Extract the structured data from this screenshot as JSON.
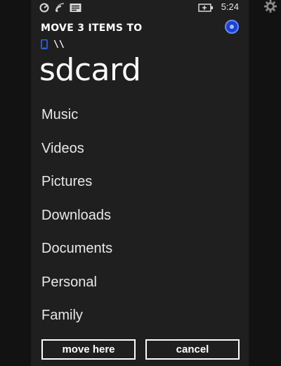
{
  "status_bar": {
    "time": "5:24",
    "icons": [
      "sync-icon",
      "wifi-icon",
      "message-icon",
      "battery-charging-icon"
    ]
  },
  "header": {
    "title": "MOVE 3 ITEMS TO",
    "path_separator": "\\\\",
    "folder": "sdcard"
  },
  "folders": [
    {
      "label": "Music"
    },
    {
      "label": "Videos"
    },
    {
      "label": "Pictures"
    },
    {
      "label": "Downloads"
    },
    {
      "label": "Documents"
    },
    {
      "label": "Personal"
    },
    {
      "label": "Family"
    }
  ],
  "buttons": {
    "move_here": "move here",
    "cancel": "cancel"
  },
  "colors": {
    "accent_blue": "#1f3fd6",
    "background": "#1f1f1f",
    "text": "#ffffff"
  }
}
